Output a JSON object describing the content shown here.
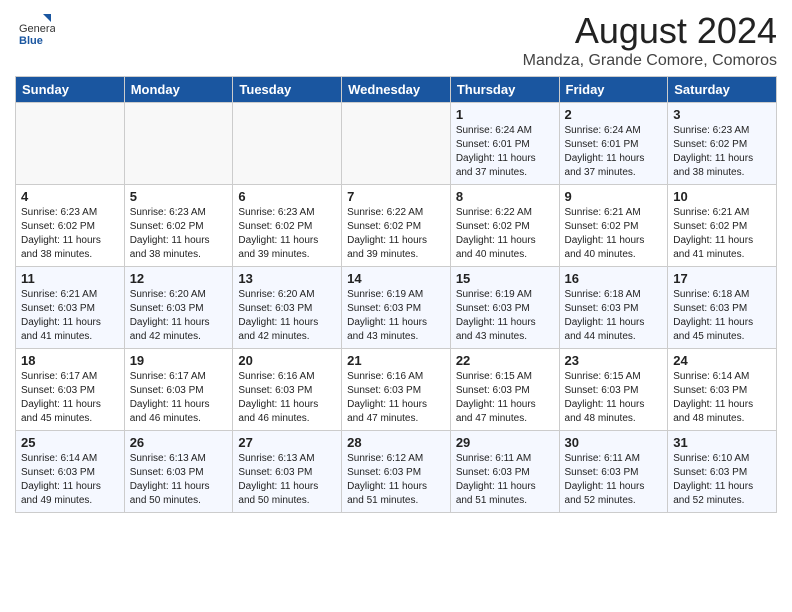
{
  "header": {
    "logo_general": "General",
    "logo_blue": "Blue",
    "month_title": "August 2024",
    "location": "Mandza, Grande Comore, Comoros"
  },
  "weekdays": [
    "Sunday",
    "Monday",
    "Tuesday",
    "Wednesday",
    "Thursday",
    "Friday",
    "Saturday"
  ],
  "weeks": [
    [
      {
        "day": "",
        "info": ""
      },
      {
        "day": "",
        "info": ""
      },
      {
        "day": "",
        "info": ""
      },
      {
        "day": "",
        "info": ""
      },
      {
        "day": "1",
        "info": "Sunrise: 6:24 AM\nSunset: 6:01 PM\nDaylight: 11 hours\nand 37 minutes."
      },
      {
        "day": "2",
        "info": "Sunrise: 6:24 AM\nSunset: 6:01 PM\nDaylight: 11 hours\nand 37 minutes."
      },
      {
        "day": "3",
        "info": "Sunrise: 6:23 AM\nSunset: 6:02 PM\nDaylight: 11 hours\nand 38 minutes."
      }
    ],
    [
      {
        "day": "4",
        "info": "Sunrise: 6:23 AM\nSunset: 6:02 PM\nDaylight: 11 hours\nand 38 minutes."
      },
      {
        "day": "5",
        "info": "Sunrise: 6:23 AM\nSunset: 6:02 PM\nDaylight: 11 hours\nand 38 minutes."
      },
      {
        "day": "6",
        "info": "Sunrise: 6:23 AM\nSunset: 6:02 PM\nDaylight: 11 hours\nand 39 minutes."
      },
      {
        "day": "7",
        "info": "Sunrise: 6:22 AM\nSunset: 6:02 PM\nDaylight: 11 hours\nand 39 minutes."
      },
      {
        "day": "8",
        "info": "Sunrise: 6:22 AM\nSunset: 6:02 PM\nDaylight: 11 hours\nand 40 minutes."
      },
      {
        "day": "9",
        "info": "Sunrise: 6:21 AM\nSunset: 6:02 PM\nDaylight: 11 hours\nand 40 minutes."
      },
      {
        "day": "10",
        "info": "Sunrise: 6:21 AM\nSunset: 6:02 PM\nDaylight: 11 hours\nand 41 minutes."
      }
    ],
    [
      {
        "day": "11",
        "info": "Sunrise: 6:21 AM\nSunset: 6:03 PM\nDaylight: 11 hours\nand 41 minutes."
      },
      {
        "day": "12",
        "info": "Sunrise: 6:20 AM\nSunset: 6:03 PM\nDaylight: 11 hours\nand 42 minutes."
      },
      {
        "day": "13",
        "info": "Sunrise: 6:20 AM\nSunset: 6:03 PM\nDaylight: 11 hours\nand 42 minutes."
      },
      {
        "day": "14",
        "info": "Sunrise: 6:19 AM\nSunset: 6:03 PM\nDaylight: 11 hours\nand 43 minutes."
      },
      {
        "day": "15",
        "info": "Sunrise: 6:19 AM\nSunset: 6:03 PM\nDaylight: 11 hours\nand 43 minutes."
      },
      {
        "day": "16",
        "info": "Sunrise: 6:18 AM\nSunset: 6:03 PM\nDaylight: 11 hours\nand 44 minutes."
      },
      {
        "day": "17",
        "info": "Sunrise: 6:18 AM\nSunset: 6:03 PM\nDaylight: 11 hours\nand 45 minutes."
      }
    ],
    [
      {
        "day": "18",
        "info": "Sunrise: 6:17 AM\nSunset: 6:03 PM\nDaylight: 11 hours\nand 45 minutes."
      },
      {
        "day": "19",
        "info": "Sunrise: 6:17 AM\nSunset: 6:03 PM\nDaylight: 11 hours\nand 46 minutes."
      },
      {
        "day": "20",
        "info": "Sunrise: 6:16 AM\nSunset: 6:03 PM\nDaylight: 11 hours\nand 46 minutes."
      },
      {
        "day": "21",
        "info": "Sunrise: 6:16 AM\nSunset: 6:03 PM\nDaylight: 11 hours\nand 47 minutes."
      },
      {
        "day": "22",
        "info": "Sunrise: 6:15 AM\nSunset: 6:03 PM\nDaylight: 11 hours\nand 47 minutes."
      },
      {
        "day": "23",
        "info": "Sunrise: 6:15 AM\nSunset: 6:03 PM\nDaylight: 11 hours\nand 48 minutes."
      },
      {
        "day": "24",
        "info": "Sunrise: 6:14 AM\nSunset: 6:03 PM\nDaylight: 11 hours\nand 48 minutes."
      }
    ],
    [
      {
        "day": "25",
        "info": "Sunrise: 6:14 AM\nSunset: 6:03 PM\nDaylight: 11 hours\nand 49 minutes."
      },
      {
        "day": "26",
        "info": "Sunrise: 6:13 AM\nSunset: 6:03 PM\nDaylight: 11 hours\nand 50 minutes."
      },
      {
        "day": "27",
        "info": "Sunrise: 6:13 AM\nSunset: 6:03 PM\nDaylight: 11 hours\nand 50 minutes."
      },
      {
        "day": "28",
        "info": "Sunrise: 6:12 AM\nSunset: 6:03 PM\nDaylight: 11 hours\nand 51 minutes."
      },
      {
        "day": "29",
        "info": "Sunrise: 6:11 AM\nSunset: 6:03 PM\nDaylight: 11 hours\nand 51 minutes."
      },
      {
        "day": "30",
        "info": "Sunrise: 6:11 AM\nSunset: 6:03 PM\nDaylight: 11 hours\nand 52 minutes."
      },
      {
        "day": "31",
        "info": "Sunrise: 6:10 AM\nSunset: 6:03 PM\nDaylight: 11 hours\nand 52 minutes."
      }
    ]
  ]
}
